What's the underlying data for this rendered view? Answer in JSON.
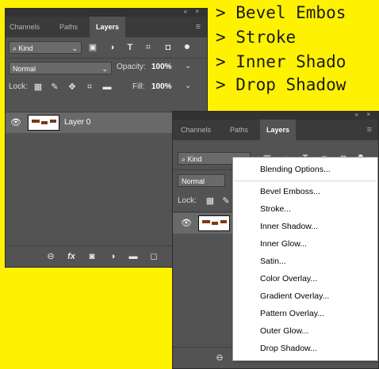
{
  "background_lines": [
    "> Bevel Embos",
    "> Stroke",
    "> Inner Shado",
    "> Drop Shadow"
  ],
  "panel": {
    "topbar_controls": "« ×",
    "tabs": [
      "Channels",
      "Paths",
      "Layers"
    ],
    "active_tab": "Layers",
    "panel_menu_icon": "≡",
    "filter_kind": "Kind",
    "blend_mode": "Normal",
    "opacity_label": "Opacity:",
    "opacity_value": "100%",
    "lock_label": "Lock:",
    "fill_label": "Fill:",
    "fill_value": "100%",
    "layer_name": "Layer 0",
    "fx_label": "fx"
  },
  "context_menu": {
    "items": [
      "Blending Options...",
      "Bevel  Emboss...",
      "Stroke...",
      "Inner Shadow...",
      "Inner Glow...",
      "Satin...",
      "Color Overlay...",
      "Gradient Overlay...",
      "Pattern Overlay...",
      "Outer Glow...",
      "Drop Shadow..."
    ]
  },
  "colors": {
    "background": "#fff200",
    "panel": "#535353",
    "tabbar": "#3a3a3a",
    "selected_layer": "#696969",
    "menu": "#ffffff"
  }
}
